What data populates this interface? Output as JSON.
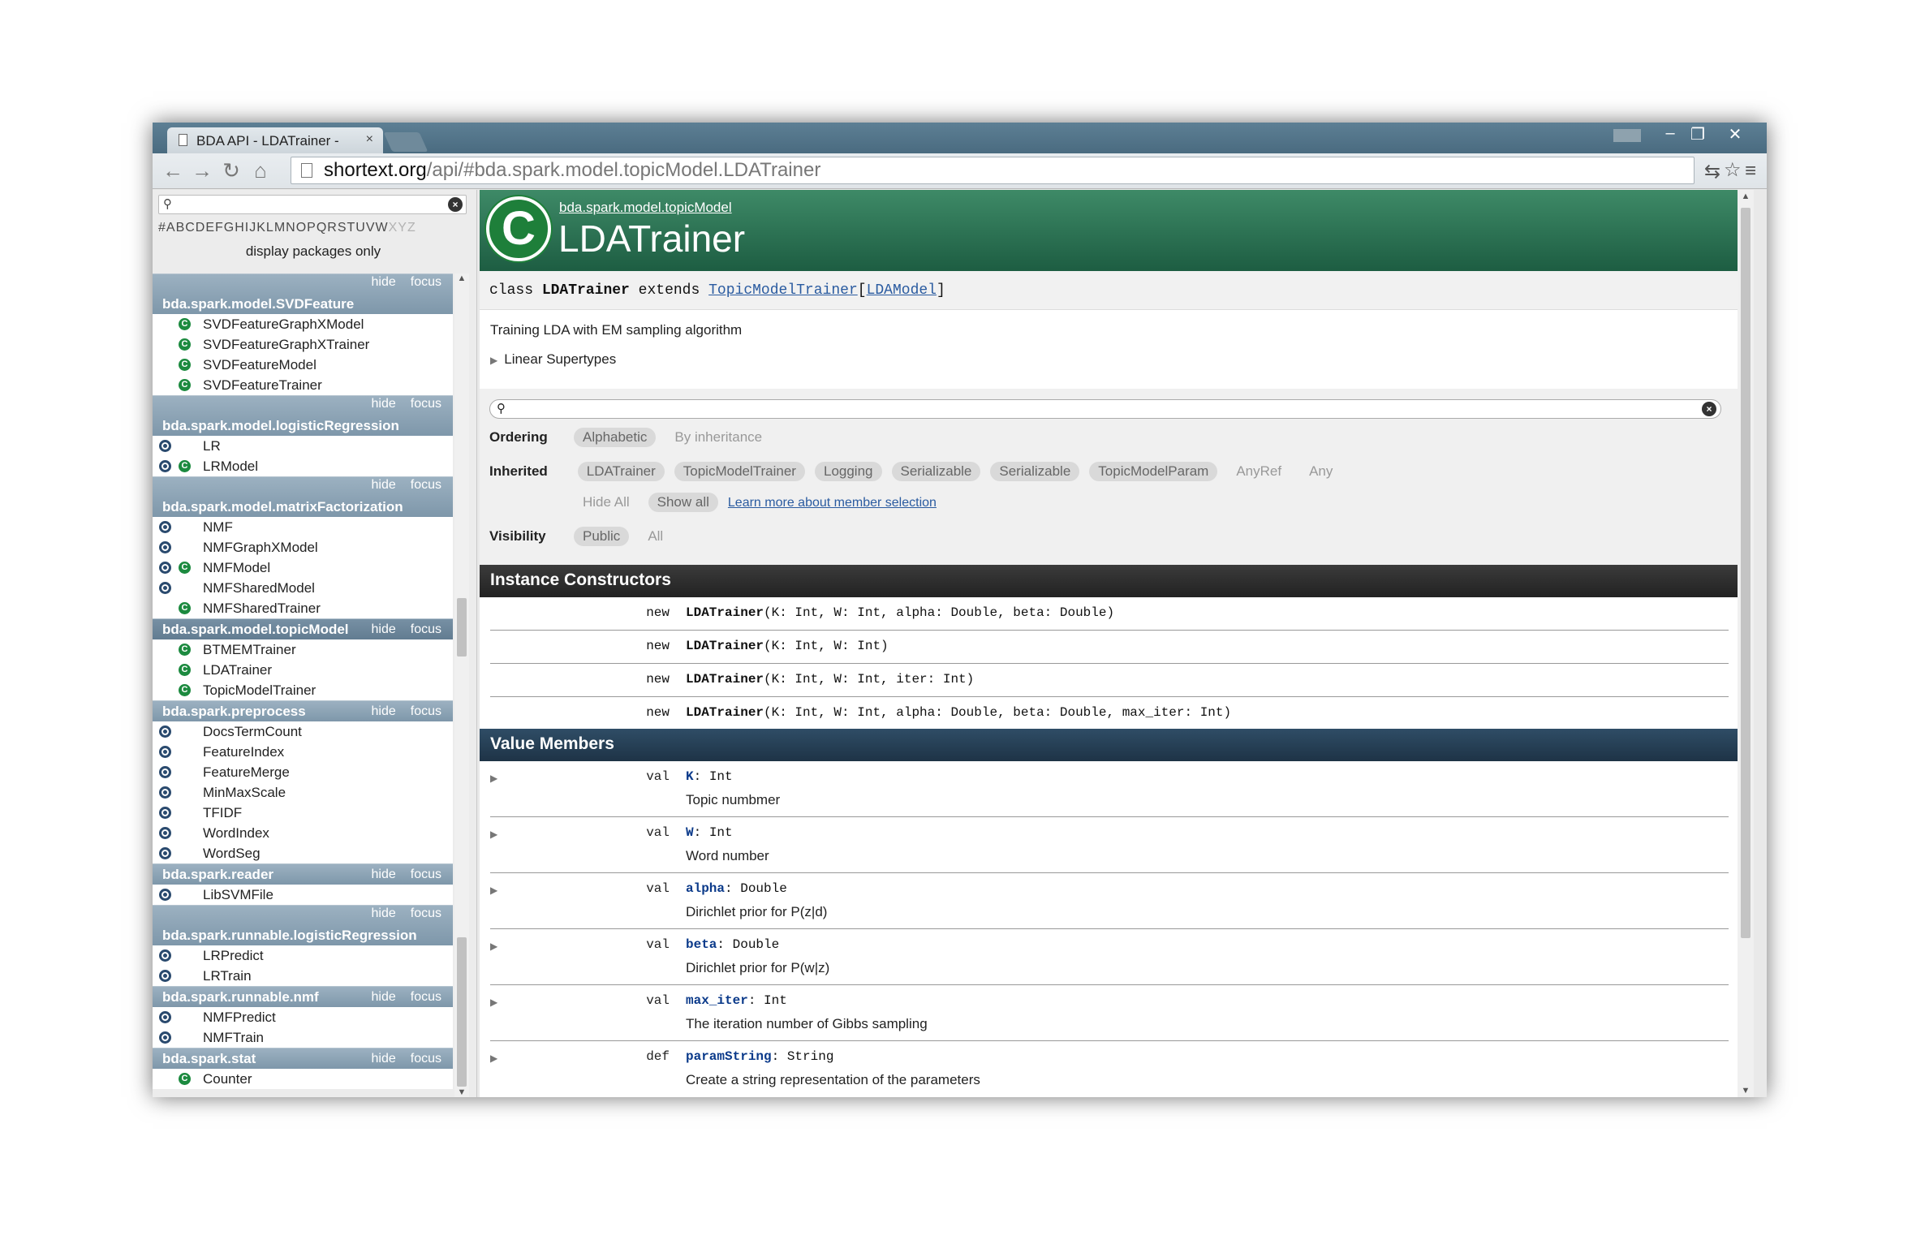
{
  "browser": {
    "tab_title": "BDA API - LDATrainer -",
    "tab_close": "×",
    "url_host": "shortext.org",
    "url_path": "/api/#bda.spark.model.topicModel.LDATrainer",
    "controls": {
      "minimize": "–",
      "restore": "❐",
      "close": "✕"
    }
  },
  "left_panel": {
    "search_placeholder": "",
    "letters_prefix": "#ABCDEFGHIJ",
    "letters_dim_1": "",
    "letters_mid": "KLMNOPQRSTUVW",
    "letters_dim_2": "XYZ",
    "display_packages_only": "display packages only",
    "hide_label": "hide",
    "focus_label": "focus",
    "packages": [
      {
        "name": "bda.spark.model.SVDFeature",
        "items": [
          {
            "label": "SVDFeatureGraphXModel",
            "object": false,
            "class": true
          },
          {
            "label": "SVDFeatureGraphXTrainer",
            "object": false,
            "class": true
          },
          {
            "label": "SVDFeatureModel",
            "object": false,
            "class": true
          },
          {
            "label": "SVDFeatureTrainer",
            "object": false,
            "class": true
          }
        ]
      },
      {
        "name": "bda.spark.model.logisticRegression",
        "items": [
          {
            "label": "LR",
            "object": true,
            "class": false
          },
          {
            "label": "LRModel",
            "object": true,
            "class": true
          }
        ]
      },
      {
        "name": "bda.spark.model.matrixFactorization",
        "items": [
          {
            "label": "NMF",
            "object": true,
            "class": false
          },
          {
            "label": "NMFGraphXModel",
            "object": true,
            "class": false
          },
          {
            "label": "NMFModel",
            "object": true,
            "class": true
          },
          {
            "label": "NMFSharedModel",
            "object": true,
            "class": false
          },
          {
            "label": "NMFSharedTrainer",
            "object": false,
            "class": true
          }
        ]
      },
      {
        "name": "bda.spark.model.topicModel",
        "items": [
          {
            "label": "BTMEMTrainer",
            "object": false,
            "class": true
          },
          {
            "label": "LDATrainer",
            "object": false,
            "class": true
          },
          {
            "label": "TopicModelTrainer",
            "object": false,
            "class": true
          }
        ]
      },
      {
        "name": "bda.spark.preprocess",
        "items": [
          {
            "label": "DocsTermCount",
            "object": true,
            "class": false
          },
          {
            "label": "FeatureIndex",
            "object": true,
            "class": false
          },
          {
            "label": "FeatureMerge",
            "object": true,
            "class": false
          },
          {
            "label": "MinMaxScale",
            "object": true,
            "class": false
          },
          {
            "label": "TFIDF",
            "object": true,
            "class": false
          },
          {
            "label": "WordIndex",
            "object": true,
            "class": false
          },
          {
            "label": "WordSeg",
            "object": true,
            "class": false
          }
        ]
      },
      {
        "name": "bda.spark.reader",
        "items": [
          {
            "label": "LibSVMFile",
            "object": true,
            "class": false
          }
        ]
      },
      {
        "name": "bda.spark.runnable.logisticRegression",
        "items": [
          {
            "label": "LRPredict",
            "object": true,
            "class": false
          },
          {
            "label": "LRTrain",
            "object": true,
            "class": false
          }
        ]
      },
      {
        "name": "bda.spark.runnable.nmf",
        "items": [
          {
            "label": "NMFPredict",
            "object": true,
            "class": false
          },
          {
            "label": "NMFTrain",
            "object": true,
            "class": false
          }
        ]
      },
      {
        "name": "bda.spark.stat",
        "items": [
          {
            "label": "Counter",
            "object": false,
            "class": true
          }
        ]
      }
    ]
  },
  "main": {
    "logo_letter": "C",
    "package_path": "bda.spark.model.topicModel",
    "class_name": "LDATrainer",
    "signature": {
      "kw_class": "class",
      "name": "LDATrainer",
      "kw_extends": "extends",
      "parent": "TopicModelTrainer",
      "bracket_open": "[",
      "type_param": "LDAModel",
      "bracket_close": "]"
    },
    "comment": "Training LDA with EM sampling algorithm",
    "linear_supertypes": "Linear Supertypes",
    "ordering": {
      "label": "Ordering",
      "alphabetic": "Alphabetic",
      "by_inheritance": "By inheritance"
    },
    "inherited": {
      "label": "Inherited",
      "pills": [
        "LDATrainer",
        "TopicModelTrainer",
        "Logging",
        "Serializable",
        "Serializable",
        "TopicModelParam"
      ],
      "plain": [
        "AnyRef",
        "Any"
      ],
      "hide_all": "Hide All",
      "show_all": "Show all",
      "learn_more": "Learn more about member selection"
    },
    "visibility": {
      "label": "Visibility",
      "public": "Public",
      "all": "All"
    },
    "constructors_title": "Instance Constructors",
    "constructors": [
      {
        "kw": "new",
        "name": "LDATrainer",
        "params": "(K: Int, W: Int, alpha: Double, beta: Double)"
      },
      {
        "kw": "new",
        "name": "LDATrainer",
        "params": "(K: Int, W: Int)"
      },
      {
        "kw": "new",
        "name": "LDATrainer",
        "params": "(K: Int, W: Int, iter: Int)"
      },
      {
        "kw": "new",
        "name": "LDATrainer",
        "params": "(K: Int, W: Int, alpha: Double, beta: Double, max_iter: Int)"
      }
    ],
    "values_title": "Value Members",
    "members": [
      {
        "kw": "val",
        "name": "K",
        "type": ": Int",
        "desc": "Topic numbmer"
      },
      {
        "kw": "val",
        "name": "W",
        "type": ": Int",
        "desc": "Word number"
      },
      {
        "kw": "val",
        "name": "alpha",
        "type": ": Double",
        "desc": "Dirichlet prior for P(z|d)"
      },
      {
        "kw": "val",
        "name": "beta",
        "type": ": Double",
        "desc": "Dirichlet prior for P(w|z)"
      },
      {
        "kw": "val",
        "name": "max_iter",
        "type": ": Int",
        "desc": "The iteration number of Gibbs sampling"
      },
      {
        "kw": "def",
        "name": "paramString",
        "type": ": String",
        "desc": "Create a string representation of the parameters"
      }
    ]
  }
}
